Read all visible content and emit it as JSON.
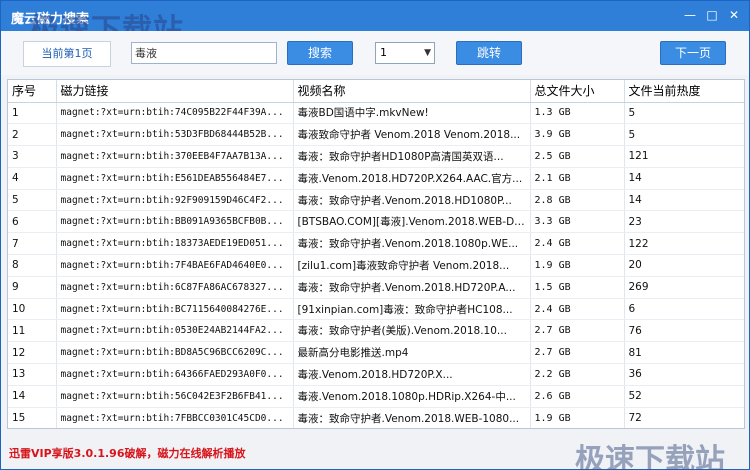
{
  "window": {
    "title": "魔云磁力搜索",
    "watermark": "极速下载站",
    "min_icon": "minimize-icon",
    "max_icon": "maximize-icon",
    "close_icon": "close-icon"
  },
  "toolbar": {
    "page_label": "当前第1页",
    "search_value": "毒液",
    "search_button": "搜索",
    "page_select_value": "1",
    "jump_button": "跳转",
    "next_button": "下一页"
  },
  "table": {
    "columns": [
      "序号",
      "磁力链接",
      "视频名称",
      "总文件大小",
      "文件当前热度"
    ],
    "rows": [
      [
        "1",
        "magnet:?xt=urn:btih:74C095B22F44F39A...",
        "毒液BD国语中字.mkvNew!",
        "1.3 GB",
        "5"
      ],
      [
        "2",
        "magnet:?xt=urn:btih:53D3FBD68444B52B...",
        "毒液致命守护者 Venom.2018 Venom.2018...",
        "3.9 GB",
        "5"
      ],
      [
        "3",
        "magnet:?xt=urn:btih:370EEB4F7AA7B13A...",
        "毒液：致命守护者HD1080P高清国英双语...",
        "2.5 GB",
        "121"
      ],
      [
        "4",
        "magnet:?xt=urn:btih:E561DEAB556484E7...",
        "毒液.Venom.2018.HD720P.X264.AAC.官方...",
        "2.1 GB",
        "14"
      ],
      [
        "5",
        "magnet:?xt=urn:btih:92F909159D46C4F2...",
        "毒液：致命守护者.Venom.2018.HD1080P...",
        "2.8 GB",
        "14"
      ],
      [
        "6",
        "magnet:?xt=urn:btih:BB091A9365BCFB0B...",
        "[BTSBAO.COM][毒液].Venom.2018.WEB-DL...",
        "3.3 GB",
        "23"
      ],
      [
        "7",
        "magnet:?xt=urn:btih:18373AEDE19ED051...",
        "毒液：致命守护者.Venom.2018.1080p.WE...",
        "2.4 GB",
        "122"
      ],
      [
        "8",
        "magnet:?xt=urn:btih:7F4BAE6FAD4640E0...",
        "[zilu1.com]毒液致命守护者 Venom.2018...",
        "1.9 GB",
        "20"
      ],
      [
        "9",
        "magnet:?xt=urn:btih:6C87FA86AC678327...",
        "毒液：致命守护者.Venom.2018.HD720P.A...",
        "1.5 GB",
        "269"
      ],
      [
        "10",
        "magnet:?xt=urn:btih:BC7115640084276E...",
        "[91xinpian.com]毒液：致命守护者HC108...",
        "2.4 GB",
        "6"
      ],
      [
        "11",
        "magnet:?xt=urn:btih:0530E24AB2144FA2...",
        "毒液：致命守护者(美版).Venom.2018.10...",
        "2.7 GB",
        "76"
      ],
      [
        "12",
        "magnet:?xt=urn:btih:BD8A5C96BCC6209C...",
        "最新高分电影推送.mp4",
        "2.7 GB",
        "81"
      ],
      [
        "13",
        "magnet:?xt=urn:btih:64366FAED293A0F0...",
        "毒液.Venom.2018.HD720P.X...",
        "2.2 GB",
        "36"
      ],
      [
        "14",
        "magnet:?xt=urn:btih:56C042E3F2B6FB41...",
        "毒液.Venom.2018.1080p.HDRip.X264-中...",
        "2.6 GB",
        "52"
      ],
      [
        "15",
        "magnet:?xt=urn:btih:7FBBCC0301C45CD0...",
        "毒液：致命守护者.Venom.2018.WEB-1080...",
        "1.9 GB",
        "72"
      ]
    ]
  },
  "status": {
    "text": "迅雷VIP享版3.0.1.96破解，磁力在线解析播放",
    "watermark": "极速下载站"
  }
}
